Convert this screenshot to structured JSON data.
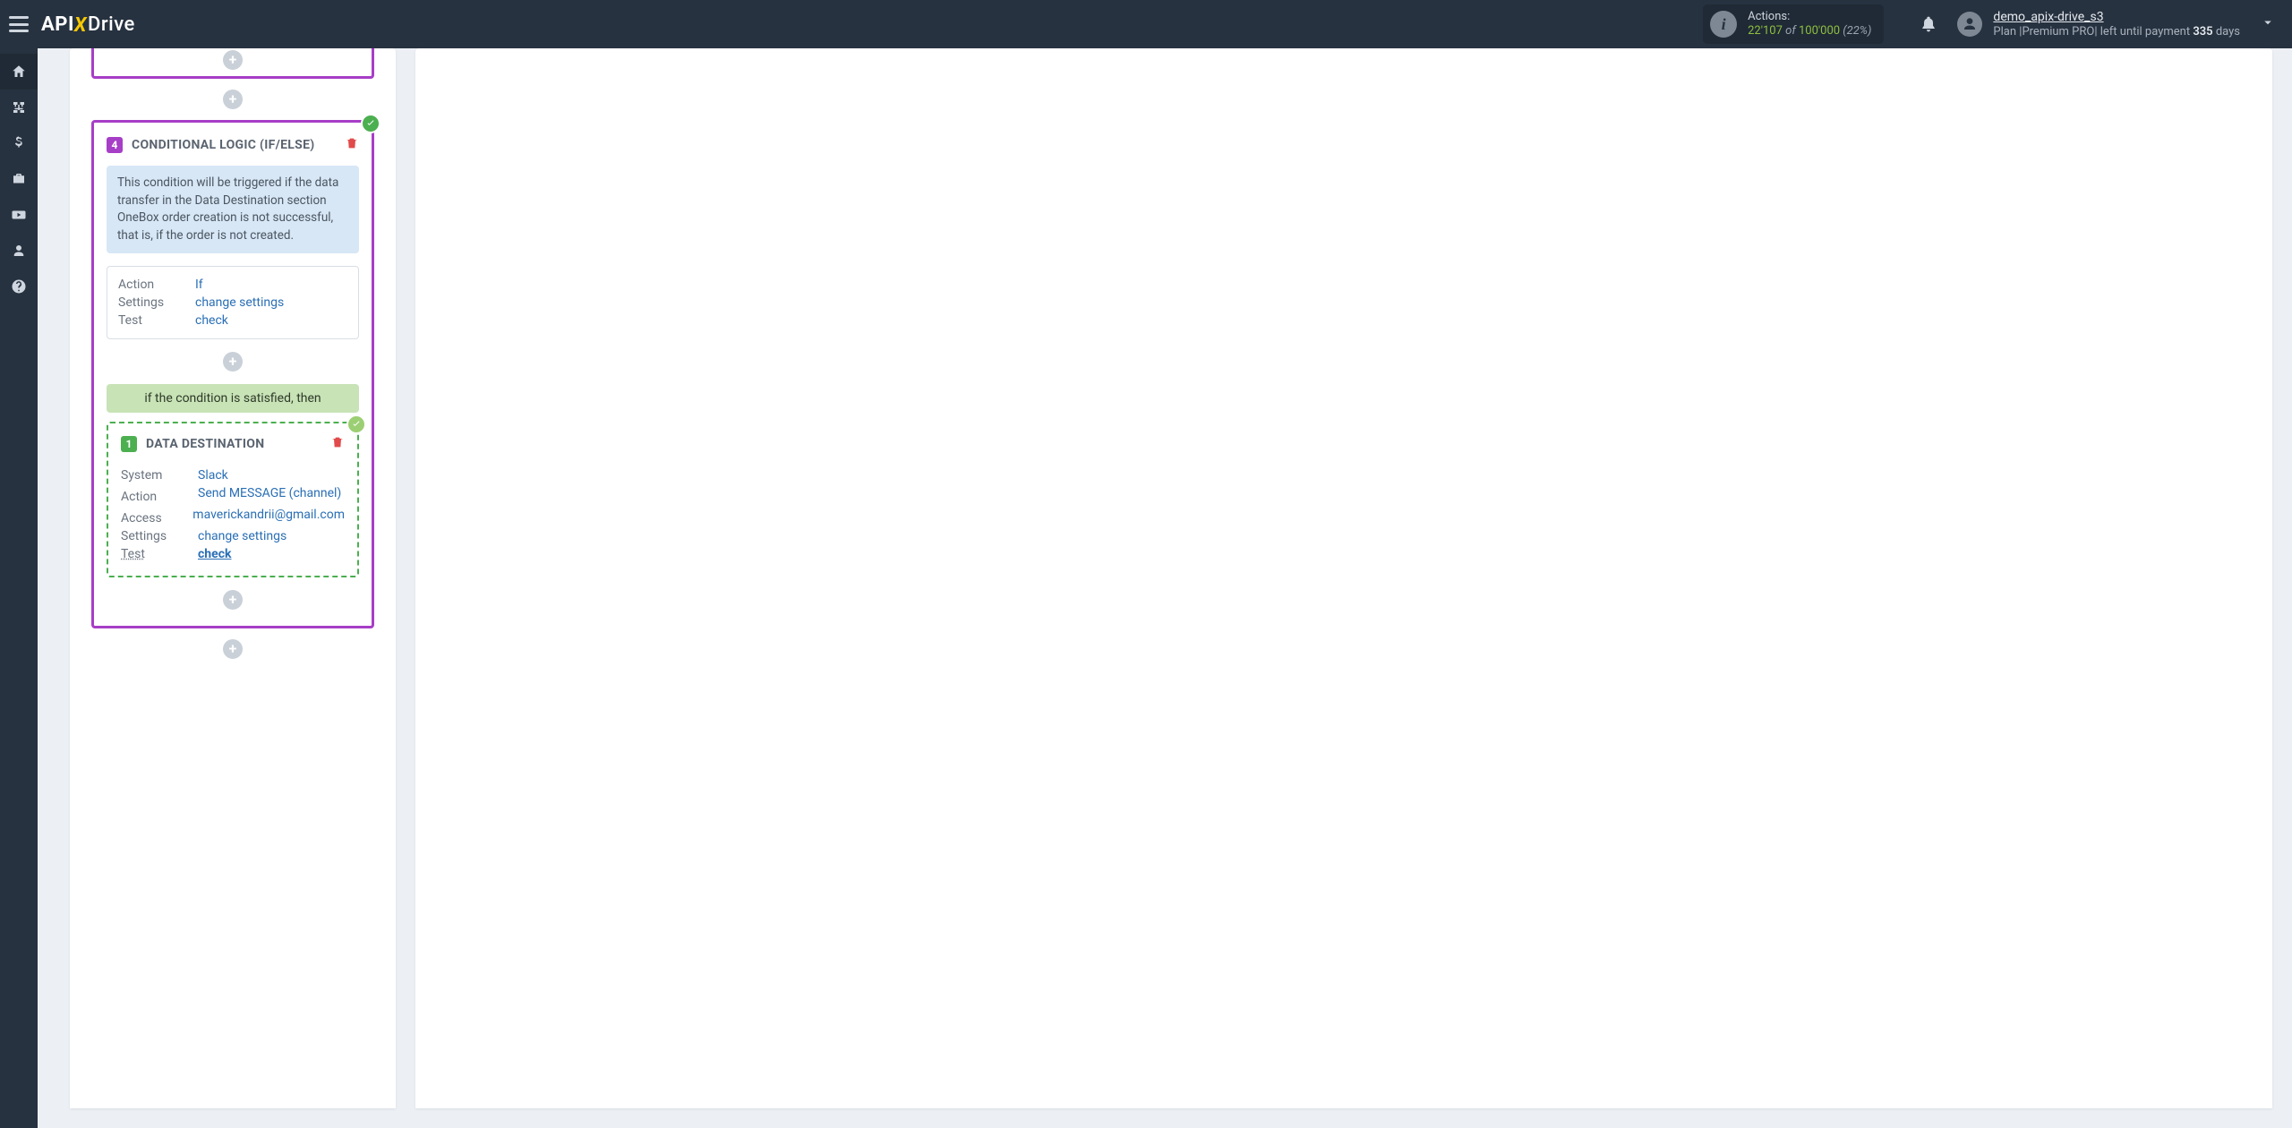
{
  "header": {
    "actions_label": "Actions:",
    "actions_used": "22'107",
    "actions_of": "of",
    "actions_limit": "100'000",
    "actions_pct": "(22%)",
    "username": "demo_apix-drive_s3",
    "plan_prefix": "Plan |",
    "plan_name": "Premium PRO",
    "plan_mid": "| left until payment",
    "plan_days": "335",
    "plan_days_suffix": "days"
  },
  "logo": {
    "api": "API",
    "x": "X",
    "drive": "Drive"
  },
  "stack": {
    "card4": {
      "num": "4",
      "title": "CONDITIONAL LOGIC (IF/ELSE)",
      "desc": "This condition will be triggered if the data transfer in the Data Destination section OneBox order creation is not successful, that is, if the order is not created.",
      "rows": {
        "action_k": "Action",
        "action_v": "If",
        "settings_k": "Settings",
        "settings_v": "change settings",
        "test_k": "Test",
        "test_v": "check"
      },
      "band": "if the condition is satisfied, then"
    },
    "nested": {
      "num": "1",
      "title": "DATA DESTINATION",
      "rows": {
        "system_k": "System",
        "system_v": "Slack",
        "action_k": "Action",
        "action_v": "Send MESSAGE (channel)",
        "access_k": "Access",
        "access_v": "maverickandrii@gmail.com",
        "settings_k": "Settings",
        "settings_v": "change settings",
        "test_k": "Test",
        "test_v": "check"
      }
    }
  }
}
